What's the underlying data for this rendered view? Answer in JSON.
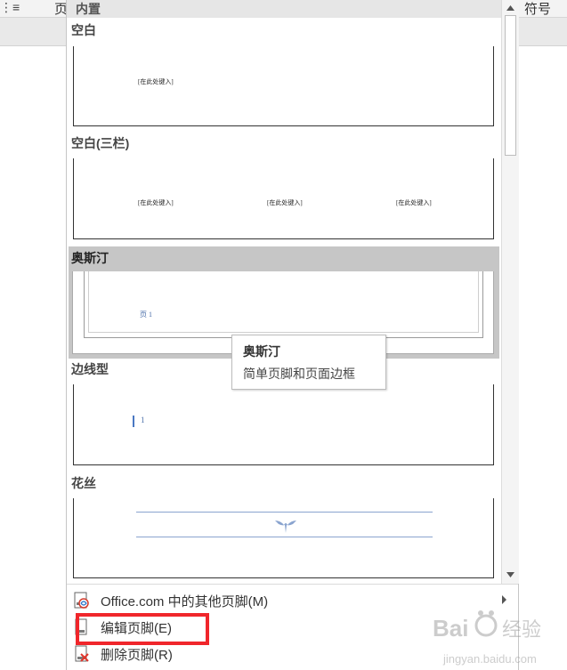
{
  "ribbon": {
    "left_glyph": "⋮≡",
    "page_label": "页",
    "symbol_label": "符号"
  },
  "gallery": {
    "header": "内置",
    "sections": [
      {
        "label": "空白",
        "placeholders": [
          "[在此处键入]"
        ]
      },
      {
        "label": "空白(三栏)",
        "placeholders": [
          "[在此处键入]",
          "[在此处键入]",
          "[在此处键入]"
        ]
      },
      {
        "label": "奥斯汀",
        "page_text": "页 1",
        "selected": true
      },
      {
        "label": "边线型",
        "page_number": "1"
      },
      {
        "label": "花丝"
      }
    ]
  },
  "tooltip": {
    "title": "奥斯汀",
    "description": "简单页脚和页面边框"
  },
  "menu": {
    "items": [
      {
        "label": "Office.com 中的其他页脚(M)",
        "icon": "office-footer-icon",
        "has_submenu": true
      },
      {
        "label": "编辑页脚(E)",
        "icon": "edit-footer-icon"
      },
      {
        "label": "删除页脚(R)",
        "icon": "delete-footer-icon"
      }
    ]
  },
  "watermark": {
    "text": "Baidu 经验",
    "sub": "jingyan.baidu.com"
  },
  "colors": {
    "highlight_red": "#f0262b",
    "selected_bg": "#c6c6c6",
    "accent_blue": "#4a6ea9"
  }
}
